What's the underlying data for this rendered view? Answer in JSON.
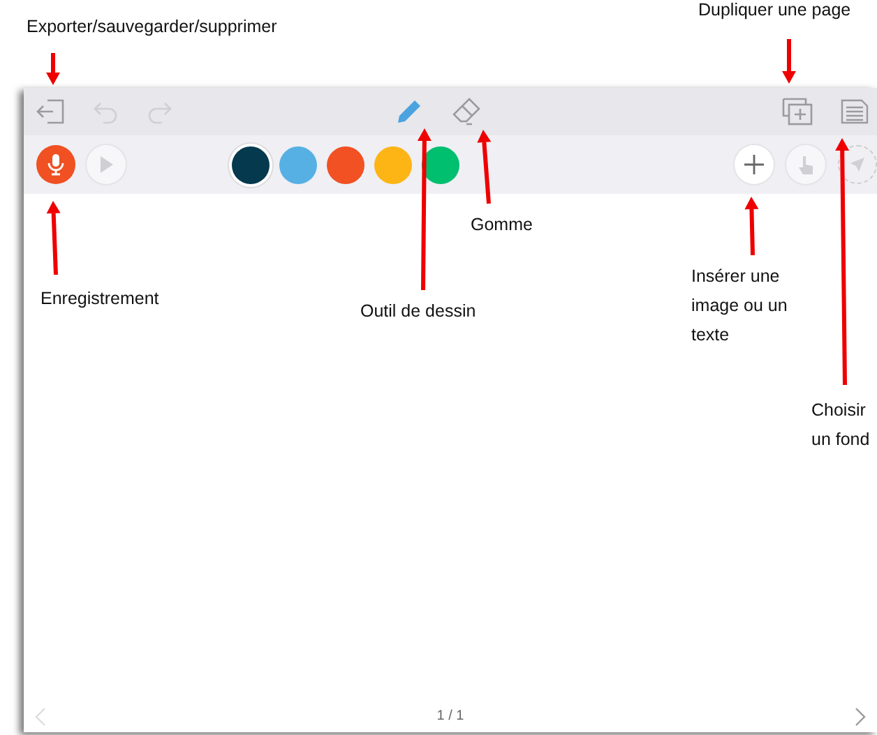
{
  "annotations": [
    {
      "text": "Exporter/sauvegarder/supprimer"
    },
    {
      "text": "Dupliquer une page"
    },
    {
      "text": "Gomme"
    },
    {
      "text": "Enregistrement"
    },
    {
      "text": "Outil de dessin"
    },
    {
      "text": "Insérer une image ou un texte"
    },
    {
      "text": "Choisir un fond"
    }
  ],
  "top_toolbar": {
    "left": [
      {
        "kind": "exit",
        "disabled": false
      },
      {
        "kind": "undo",
        "disabled": true
      },
      {
        "kind": "redo",
        "disabled": true
      }
    ],
    "tools": [
      {
        "kind": "pencil",
        "selected": true
      },
      {
        "kind": "eraser",
        "selected": false
      }
    ],
    "right": [
      {
        "kind": "duplicate",
        "disabled": false
      },
      {
        "kind": "background",
        "disabled": false
      }
    ]
  },
  "second_toolbar": {
    "left": [
      {
        "kind": "record",
        "disabled": false
      },
      {
        "kind": "play",
        "disabled": true
      }
    ],
    "colors": [
      {
        "color": "#04394e",
        "selected": true
      },
      {
        "color": "#56b0e3",
        "selected": false
      },
      {
        "color": "#f15123",
        "selected": false
      },
      {
        "color": "#fdb515",
        "selected": false
      },
      {
        "color": "#00bf6f",
        "selected": false
      }
    ],
    "right": [
      {
        "kind": "insert",
        "disabled": false
      },
      {
        "kind": "hand",
        "disabled": true
      },
      {
        "kind": "pointer",
        "disabled": true
      }
    ]
  },
  "pager": {
    "prev_disabled": true,
    "next_disabled": false,
    "label": "1 / 1"
  }
}
